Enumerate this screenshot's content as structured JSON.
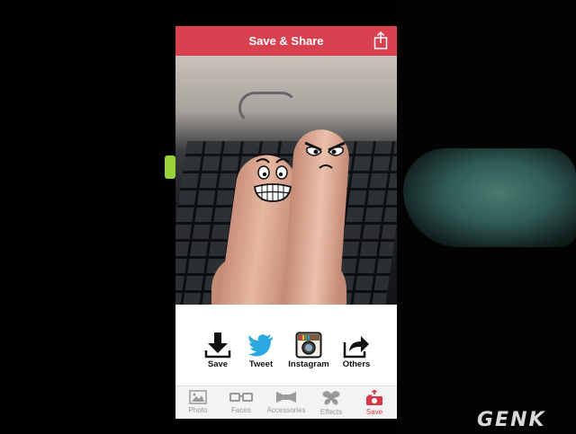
{
  "header": {
    "title": "Save & Share",
    "share_icon": "share-icon"
  },
  "share_actions": [
    {
      "label": "Save",
      "icon": "download-icon"
    },
    {
      "label": "Tweet",
      "icon": "twitter-bird-icon"
    },
    {
      "label": "Instagram",
      "icon": "instagram-camera-icon"
    },
    {
      "label": "Others",
      "icon": "share-arrow-icon"
    }
  ],
  "tabs": [
    {
      "label": "Photo",
      "icon": "photo-icon",
      "active": false
    },
    {
      "label": "Faces",
      "icon": "glasses-icon",
      "active": false
    },
    {
      "label": "Accessories",
      "icon": "bowtie-icon",
      "active": false
    },
    {
      "label": "Effects",
      "icon": "butterfly-icon",
      "active": false
    },
    {
      "label": "Save",
      "icon": "camera-upload-icon",
      "active": true
    }
  ],
  "watermark": "GENK",
  "colors": {
    "accent": "#d94150",
    "active_tab": "#d63a49",
    "tab_inactive": "#999999"
  }
}
